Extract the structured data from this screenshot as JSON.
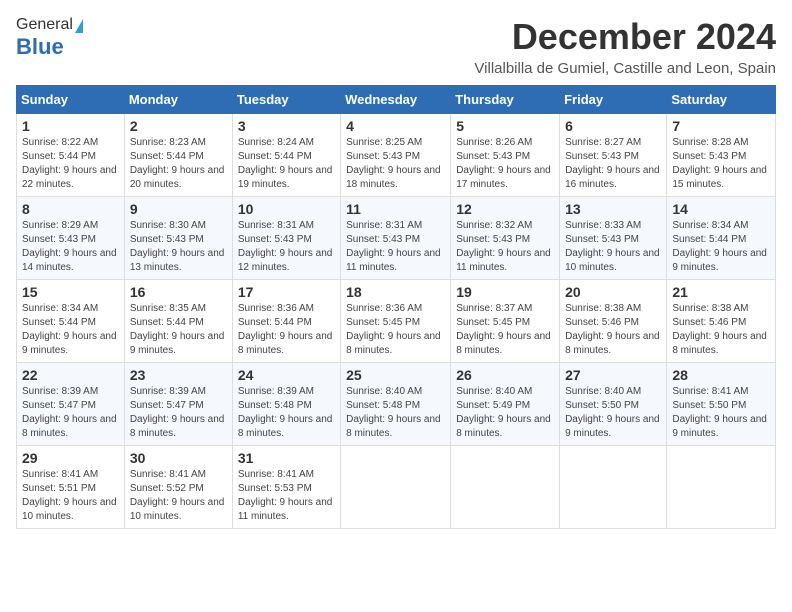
{
  "logo": {
    "general": "General",
    "blue": "Blue"
  },
  "header": {
    "month": "December 2024",
    "location": "Villalbilla de Gumiel, Castille and Leon, Spain"
  },
  "days": [
    "Sunday",
    "Monday",
    "Tuesday",
    "Wednesday",
    "Thursday",
    "Friday",
    "Saturday"
  ],
  "weeks": [
    [
      {
        "day": "1",
        "sunrise": "8:22 AM",
        "sunset": "5:44 PM",
        "daylight": "9 hours and 22 minutes."
      },
      {
        "day": "2",
        "sunrise": "8:23 AM",
        "sunset": "5:44 PM",
        "daylight": "9 hours and 20 minutes."
      },
      {
        "day": "3",
        "sunrise": "8:24 AM",
        "sunset": "5:44 PM",
        "daylight": "9 hours and 19 minutes."
      },
      {
        "day": "4",
        "sunrise": "8:25 AM",
        "sunset": "5:43 PM",
        "daylight": "9 hours and 18 minutes."
      },
      {
        "day": "5",
        "sunrise": "8:26 AM",
        "sunset": "5:43 PM",
        "daylight": "9 hours and 17 minutes."
      },
      {
        "day": "6",
        "sunrise": "8:27 AM",
        "sunset": "5:43 PM",
        "daylight": "9 hours and 16 minutes."
      },
      {
        "day": "7",
        "sunrise": "8:28 AM",
        "sunset": "5:43 PM",
        "daylight": "9 hours and 15 minutes."
      }
    ],
    [
      {
        "day": "8",
        "sunrise": "8:29 AM",
        "sunset": "5:43 PM",
        "daylight": "9 hours and 14 minutes."
      },
      {
        "day": "9",
        "sunrise": "8:30 AM",
        "sunset": "5:43 PM",
        "daylight": "9 hours and 13 minutes."
      },
      {
        "day": "10",
        "sunrise": "8:31 AM",
        "sunset": "5:43 PM",
        "daylight": "9 hours and 12 minutes."
      },
      {
        "day": "11",
        "sunrise": "8:31 AM",
        "sunset": "5:43 PM",
        "daylight": "9 hours and 11 minutes."
      },
      {
        "day": "12",
        "sunrise": "8:32 AM",
        "sunset": "5:43 PM",
        "daylight": "9 hours and 11 minutes."
      },
      {
        "day": "13",
        "sunrise": "8:33 AM",
        "sunset": "5:43 PM",
        "daylight": "9 hours and 10 minutes."
      },
      {
        "day": "14",
        "sunrise": "8:34 AM",
        "sunset": "5:44 PM",
        "daylight": "9 hours and 9 minutes."
      }
    ],
    [
      {
        "day": "15",
        "sunrise": "8:34 AM",
        "sunset": "5:44 PM",
        "daylight": "9 hours and 9 minutes."
      },
      {
        "day": "16",
        "sunrise": "8:35 AM",
        "sunset": "5:44 PM",
        "daylight": "9 hours and 9 minutes."
      },
      {
        "day": "17",
        "sunrise": "8:36 AM",
        "sunset": "5:44 PM",
        "daylight": "9 hours and 8 minutes."
      },
      {
        "day": "18",
        "sunrise": "8:36 AM",
        "sunset": "5:45 PM",
        "daylight": "9 hours and 8 minutes."
      },
      {
        "day": "19",
        "sunrise": "8:37 AM",
        "sunset": "5:45 PM",
        "daylight": "9 hours and 8 minutes."
      },
      {
        "day": "20",
        "sunrise": "8:38 AM",
        "sunset": "5:46 PM",
        "daylight": "9 hours and 8 minutes."
      },
      {
        "day": "21",
        "sunrise": "8:38 AM",
        "sunset": "5:46 PM",
        "daylight": "9 hours and 8 minutes."
      }
    ],
    [
      {
        "day": "22",
        "sunrise": "8:39 AM",
        "sunset": "5:47 PM",
        "daylight": "9 hours and 8 minutes."
      },
      {
        "day": "23",
        "sunrise": "8:39 AM",
        "sunset": "5:47 PM",
        "daylight": "9 hours and 8 minutes."
      },
      {
        "day": "24",
        "sunrise": "8:39 AM",
        "sunset": "5:48 PM",
        "daylight": "9 hours and 8 minutes."
      },
      {
        "day": "25",
        "sunrise": "8:40 AM",
        "sunset": "5:48 PM",
        "daylight": "9 hours and 8 minutes."
      },
      {
        "day": "26",
        "sunrise": "8:40 AM",
        "sunset": "5:49 PM",
        "daylight": "9 hours and 8 minutes."
      },
      {
        "day": "27",
        "sunrise": "8:40 AM",
        "sunset": "5:50 PM",
        "daylight": "9 hours and 9 minutes."
      },
      {
        "day": "28",
        "sunrise": "8:41 AM",
        "sunset": "5:50 PM",
        "daylight": "9 hours and 9 minutes."
      }
    ],
    [
      {
        "day": "29",
        "sunrise": "8:41 AM",
        "sunset": "5:51 PM",
        "daylight": "9 hours and 10 minutes."
      },
      {
        "day": "30",
        "sunrise": "8:41 AM",
        "sunset": "5:52 PM",
        "daylight": "9 hours and 10 minutes."
      },
      {
        "day": "31",
        "sunrise": "8:41 AM",
        "sunset": "5:53 PM",
        "daylight": "9 hours and 11 minutes."
      },
      null,
      null,
      null,
      null
    ]
  ]
}
